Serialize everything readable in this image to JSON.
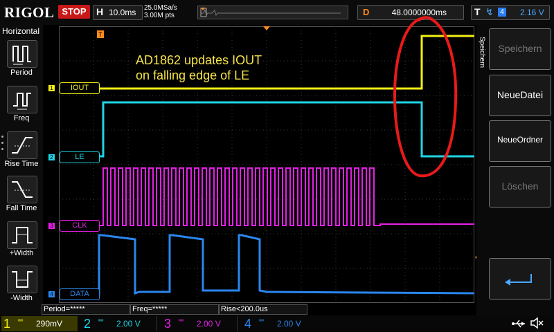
{
  "header": {
    "brand": "RIGOL",
    "run_state": "STOP",
    "timebase_key": "H",
    "timebase_value": "10.0ms",
    "sample_rate": "25.0MSa/s",
    "memory_points": "3.00M pts",
    "delay_key": "D",
    "delay_value": "48.0000000ms",
    "trigger_key": "T",
    "trigger_source": "4",
    "trigger_level": "2.16 V"
  },
  "left_panel": {
    "title": "Horizontal",
    "items": [
      {
        "label": "Period",
        "icon": "period-icon"
      },
      {
        "label": "Freq",
        "icon": "freq-icon"
      },
      {
        "label": "Rise Time",
        "icon": "rise-time-icon"
      },
      {
        "label": "Fall Time",
        "icon": "fall-time-icon"
      },
      {
        "label": "+Width",
        "icon": "pos-width-icon"
      },
      {
        "label": "-Width",
        "icon": "neg-width-icon"
      }
    ]
  },
  "annotation": {
    "line1": "AD1862 updates IOUT",
    "line2": "on falling edge of LE"
  },
  "channels": [
    {
      "num": "1",
      "label": "IOUT",
      "color": "#f3ef14"
    },
    {
      "num": "2",
      "label": "LE",
      "color": "#1fd6e6"
    },
    {
      "num": "3",
      "label": "CLK",
      "color": "#e61fe6"
    },
    {
      "num": "4",
      "label": "DATA",
      "color": "#2a86ee"
    }
  ],
  "right_panel": {
    "title": "Speichern",
    "buttons": [
      {
        "label": "Speichern",
        "enabled": false
      },
      {
        "label": "NeueDatei",
        "enabled": true
      },
      {
        "label": "NeueOrdner",
        "enabled": true
      },
      {
        "label": "Löschen",
        "enabled": false
      }
    ],
    "enter_icon": "enter-icon"
  },
  "measurements": [
    {
      "text": "Period=*****"
    },
    {
      "text": "Freq=*****"
    },
    {
      "text": "Rise<200.0us"
    }
  ],
  "bottom": {
    "channels": [
      {
        "num": "1",
        "scale": "290mV",
        "color": "#f3ef14"
      },
      {
        "num": "2",
        "scale": "2.00 V",
        "color": "#1fd6e6"
      },
      {
        "num": "3",
        "scale": "2.00 V",
        "color": "#e61fe6"
      },
      {
        "num": "4",
        "scale": "2.00 V",
        "color": "#2a86ee"
      }
    ],
    "usb_icon": "usb-icon",
    "sound_icon": "sound-muted-icon"
  }
}
